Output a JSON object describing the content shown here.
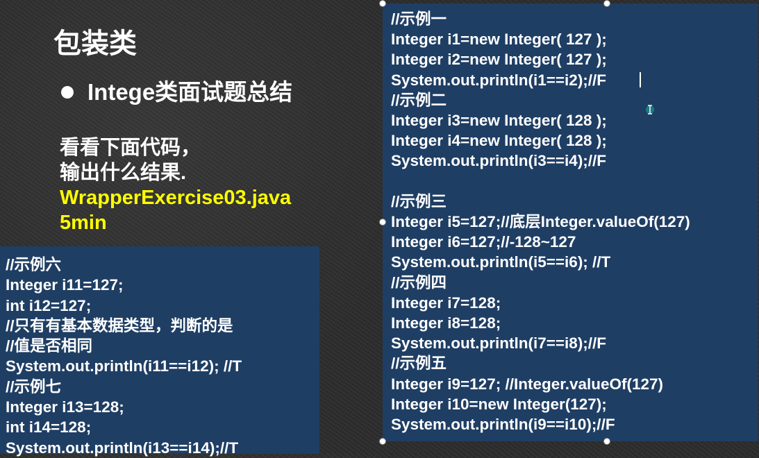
{
  "slide": {
    "title": "包装类",
    "bullet": "Intege类面试题总结",
    "prompt_lines": [
      "看看下面代码，",
      "输出什么结果."
    ],
    "highlight_lines": [
      "WrapperExercise03.java",
      "5min"
    ]
  },
  "code_left": {
    "lines": [
      "//示例六",
      "Integer i11=127;",
      "int i12=127;",
      "//只有有基本数据类型，判断的是",
      "//值是否相同",
      "System.out.println(i11==i12); //T",
      "//示例七",
      "Integer i13=128;",
      "int i14=128;",
      "System.out.println(i13==i14);//T"
    ]
  },
  "code_right": {
    "lines": [
      "//示例一",
      "Integer i1=new Integer( 127 );",
      "Integer i2=new Integer( 127 );",
      "System.out.println(i1==i2);//F",
      "//示例二",
      "Integer i3=new Integer( 128 );",
      "Integer i4=new Integer( 128 );",
      "System.out.println(i3==i4);//F",
      "",
      "//示例三",
      "Integer i5=127;//底层Integer.valueOf(127)",
      "Integer i6=127;//-128~127",
      "System.out.println(i5==i6); //T",
      "//示例四",
      "Integer i7=128;",
      "Integer i8=128;",
      "System.out.println(i7==i8);//F",
      "//示例五",
      "Integer i9=127; //Integer.valueOf(127)",
      "Integer i10=new Integer(127);",
      "System.out.println(i9==i10);//F"
    ]
  },
  "colors": {
    "background": "#2b2b2b",
    "code_box": "#1f3e64",
    "highlight": "#ffff00",
    "text": "#ffffff"
  }
}
